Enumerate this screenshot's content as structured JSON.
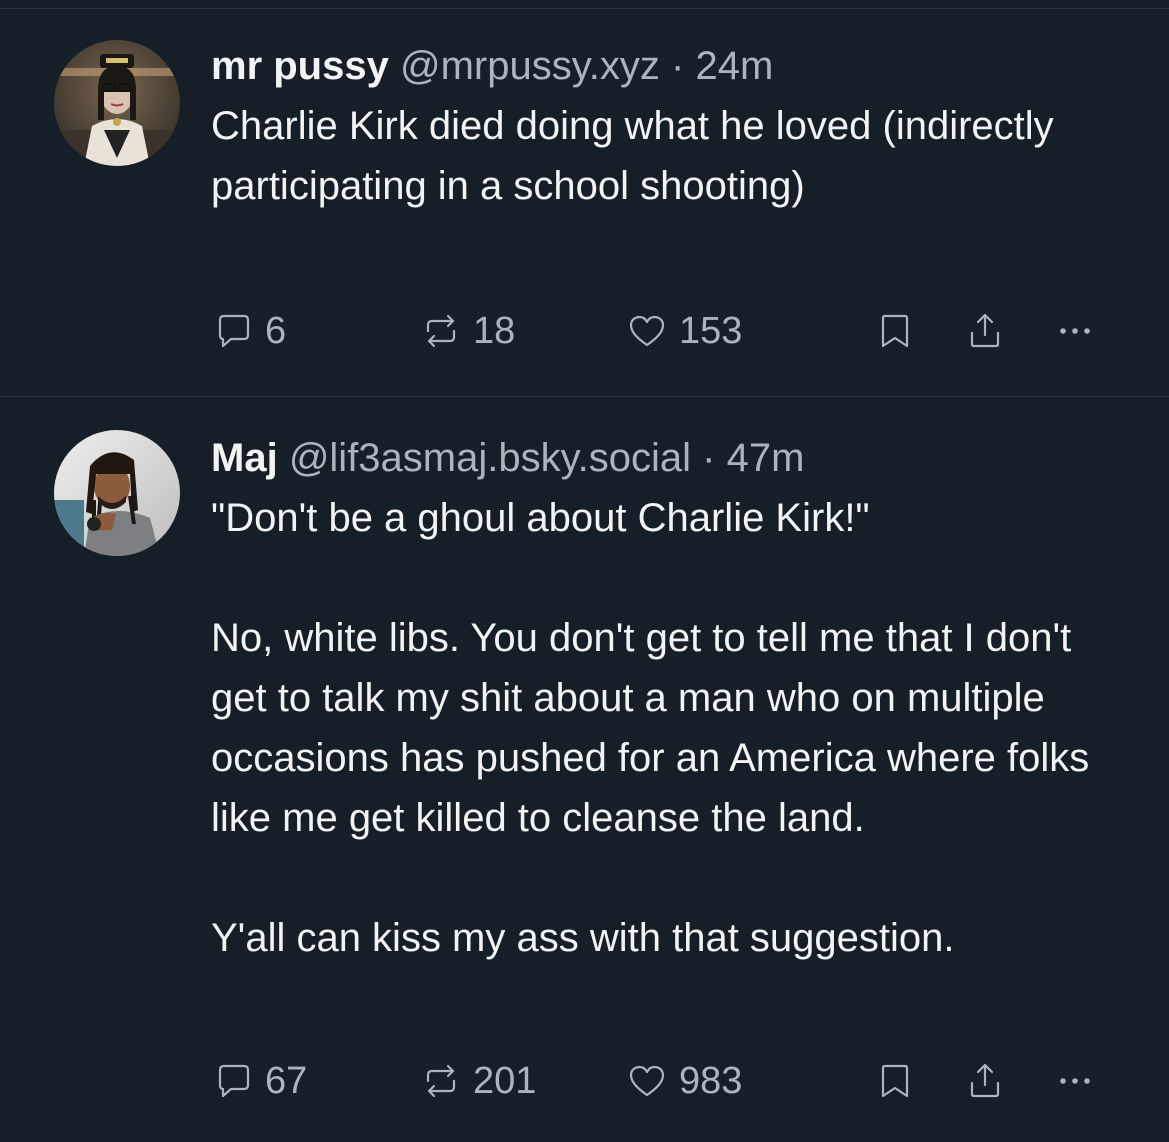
{
  "posts": [
    {
      "display_name": "mr pussy",
      "handle": "@mrpussy.xyz",
      "separator": "·",
      "time": "24m",
      "paragraphs": [
        "Charlie Kirk died doing what he loved (indirectly participating in a school shooting)"
      ],
      "counts": {
        "replies": "6",
        "reposts": "18",
        "likes": "153"
      }
    },
    {
      "display_name": "Maj",
      "handle": "@lif3asmaj.bsky.social",
      "separator": "·",
      "time": "47m",
      "paragraphs": [
        "\"Don't be a ghoul about Charlie Kirk!\"",
        "No, white libs. You don't get to tell me that I don't get to talk my shit about a man who on multiple occasions has pushed for an America where folks like me get killed to cleanse the land.",
        "Y'all can kiss my ass with that suggestion."
      ],
      "counts": {
        "replies": "67",
        "reposts": "201",
        "likes": "983"
      }
    }
  ],
  "icons": {
    "reply": "speech-bubble-icon",
    "repost": "repost-arrows-icon",
    "like": "heart-icon",
    "bookmark": "bookmark-icon",
    "share": "share-upload-icon",
    "more": "ellipsis-icon"
  },
  "colors": {
    "background": "#161e27",
    "primary_text": "#f1f3f5",
    "secondary_text": "#aab4bf",
    "divider": "#2b3540"
  }
}
